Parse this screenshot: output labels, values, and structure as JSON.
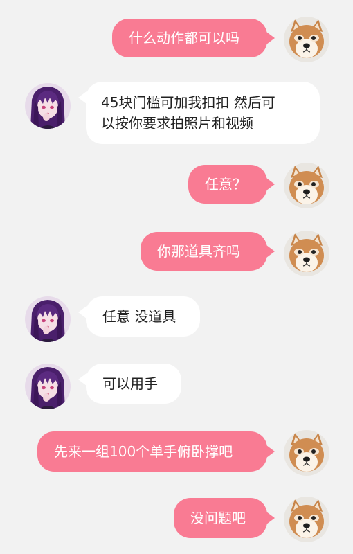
{
  "colors": {
    "sent_bubble": "#f97b93",
    "received_bubble": "#ffffff",
    "background": "#f2f2f2"
  },
  "messages": [
    {
      "side": "right",
      "text": "什么动作都可以吗",
      "avatar": "shiba-avatar"
    },
    {
      "side": "left",
      "text": "45块门槛可加我扣扣 然后可\n以按你要求拍照片和视频",
      "avatar": "anime-girl-avatar"
    },
    {
      "side": "right",
      "text": "任意？",
      "avatar": "shiba-avatar"
    },
    {
      "side": "right",
      "text": "你那道具齐吗",
      "avatar": "shiba-avatar"
    },
    {
      "side": "left",
      "text": "任意 没道具",
      "avatar": "anime-girl-avatar"
    },
    {
      "side": "left",
      "text": "可以用手",
      "avatar": "anime-girl-avatar"
    },
    {
      "side": "right",
      "text": "先来一组100个单手俯卧撑吧",
      "avatar": "shiba-avatar"
    },
    {
      "side": "right",
      "text": "没问题吧",
      "avatar": "shiba-avatar"
    }
  ]
}
